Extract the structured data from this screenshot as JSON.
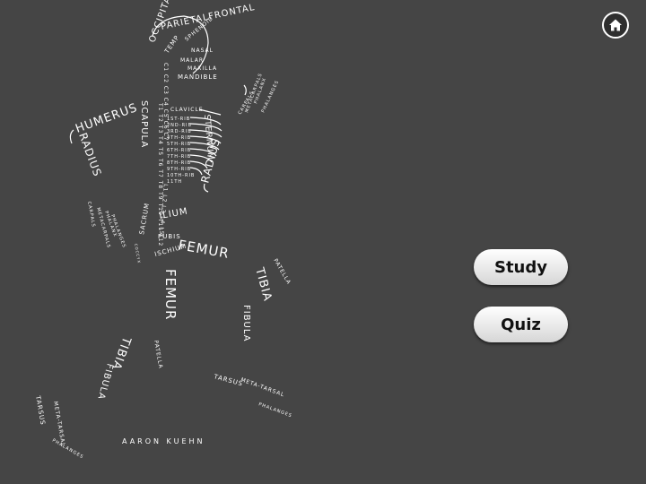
{
  "artwork": {
    "credit": "AARON    KUEHN",
    "labels": {
      "parietal_frontal": "PARIETALFRONTAL",
      "occipital": "OCCIPITAL",
      "temporal": "TEMP",
      "sphenoid": "SPHENOID",
      "nasal": "NASAL",
      "malar": "MALAR",
      "maxilla": "MAXILLA",
      "mandible": "MANDIBLE",
      "cervical": "C1 C2 C3 C4 C5 C6 C7",
      "humerus_left": "HUMERUS",
      "radius_left": "RADIUS",
      "scapula": "SCAPULA",
      "sternum": "STERNUM",
      "clavicle": "CLAVICLE",
      "ribs": [
        "1ST-RIB",
        "2ND-RIB",
        "3RD-RIB",
        "4TH-RIB",
        "5TH-RIB",
        "6TH-RIB",
        "7TH-RIB",
        "8TH-RIB",
        "9TH-RIB",
        "10TH-RIB",
        "11TH",
        "12TH"
      ],
      "thoracic": "T1 T2 T3 T4 T5 T6 T7 T8 T9 T10 T11 T12",
      "lumbar": "L1 L2 L3 L4 L5",
      "radius_right": "RADIUS",
      "humerus_right": "HUMERUS",
      "carpals": "CARPALS",
      "metacarpals": "METACARPALS",
      "phalanx": "PHALANX",
      "phalanges": "PHALANGES",
      "sacrum": "SACRUM",
      "ilium": "ILIUM",
      "pubis": "PUBIS",
      "ischium": "ISCHIUM",
      "coccyx": "COCCYX",
      "femur_right": "FEMUR",
      "femur_left": "FEMUR",
      "patella": "PATELLA",
      "tibia": "TIBIA",
      "fibula": "FIBULA",
      "tarsus": "TARSUS",
      "metatarsal": "META-TARSAL",
      "foot_phalanges": "PHALANGES"
    }
  },
  "nav": {
    "home_icon": "home-icon"
  },
  "buttons": {
    "study": "Study",
    "quiz": "Quiz"
  }
}
